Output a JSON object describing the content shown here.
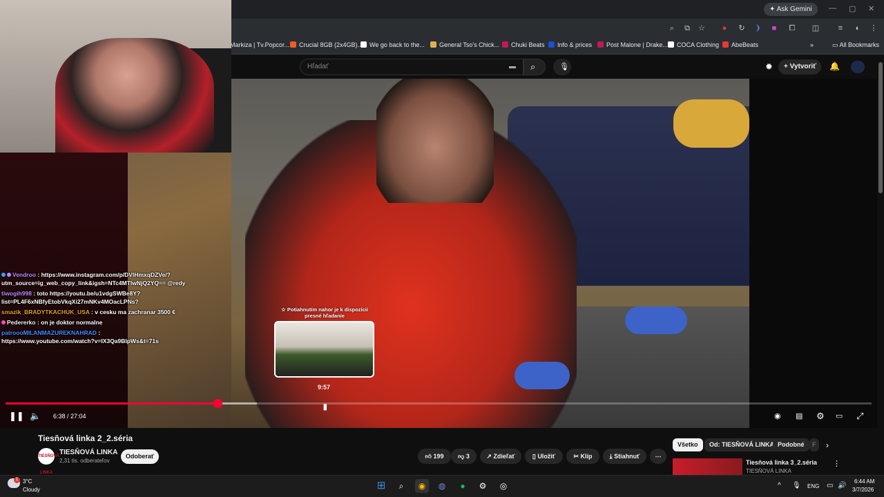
{
  "browser": {
    "ask_gemini": "Ask Gemini",
    "bookmarks": [
      {
        "label": "Markiza | Tv.Popcor...",
        "color": "#2a2d31"
      },
      {
        "label": "Crucial 8GB (2x4GB)...",
        "color": "#f25c23"
      },
      {
        "label": "We go back to the...",
        "color": "#ffffff"
      },
      {
        "label": "General Tso's Chick...",
        "color": "#e0b050"
      },
      {
        "label": "Chuki Beats",
        "color": "#c2185b"
      },
      {
        "label": "Info & prices",
        "color": "#1a4fd6"
      },
      {
        "label": "Post Malone | Drake...",
        "color": "#c2185b"
      },
      {
        "label": "COCA Clothing",
        "color": "#ffffff"
      },
      {
        "label": "AbeBeats",
        "color": "#e53935"
      }
    ],
    "all_bookmarks": "All Bookmarks"
  },
  "youtube": {
    "search_placeholder": "Hľadať",
    "create_label": "Vytvoriť"
  },
  "chat": [
    {
      "user": "Vendroo",
      "user_color": "#b18cff",
      "text": "https://www.instagram.com/p/DVlHmxqDZVe/?utm_source=ig_web_copy_link&igsh=NTc4MTIwNjQ2YQ== @redy"
    },
    {
      "user": "tiwogih998",
      "user_color": "#b18cff",
      "text": "toto https://youtu.be/u1vdgSWBe8Y?list=PL4F6xNBfyEtobVkqXi27mNKv4MOacLPNs?"
    },
    {
      "user": "smazik_BRADYTKACHUK_USA",
      "user_color": "#e0a020",
      "text": "v cesku ma zachranar 3500 €"
    },
    {
      "user": "Pedererko",
      "user_color": "#f0f0f0",
      "text": "on je doktor normalne"
    },
    {
      "user": "patroooMILANMAZUREKNAHRAD",
      "user_color": "#3d8bff",
      "text": "https://www.youtube.com/watch?v=IX3Qa9BlpWs&t=71s"
    }
  ],
  "player": {
    "preview_text": "☆ Potiahnutím nahor je k dispozícii presné hľadanie",
    "preview_time": "9:57",
    "current_time": "6:38",
    "duration": "27:04",
    "time_display": "6:38 / 27:04",
    "played_fraction": 0.245,
    "buffered_fraction": 0.29,
    "hover_fraction": 0.368,
    "accent": "#ff0033"
  },
  "video": {
    "title": "Tiesňová linka 2_2.séria",
    "channel_name": "TIESŇOVÁ LINKA",
    "channel_avatar_text": "TIESŇOVÁ LINKA",
    "subscribers": "2,31 tis. odberateľov",
    "subscribe_label": "Odoberať",
    "likes": "199",
    "dislikes": "3",
    "share_label": "Zdieľať",
    "save_label": "Uložiť",
    "clip_label": "Klip",
    "download_label": "Stiahnuť"
  },
  "chips": [
    "Všetko",
    "Od: TIESŇOVÁ LINKA",
    "Podobné",
    "F"
  ],
  "recommended": {
    "title": "Tiesňová linka 3_2.séria",
    "channel": "TIESŇOVÁ LINKA"
  },
  "taskbar": {
    "weather_temp": "3°C",
    "weather_desc": "Cloudy",
    "weather_badge": "1",
    "lang": "ENG",
    "time": "6:44 AM",
    "date": "3/7/2026"
  }
}
